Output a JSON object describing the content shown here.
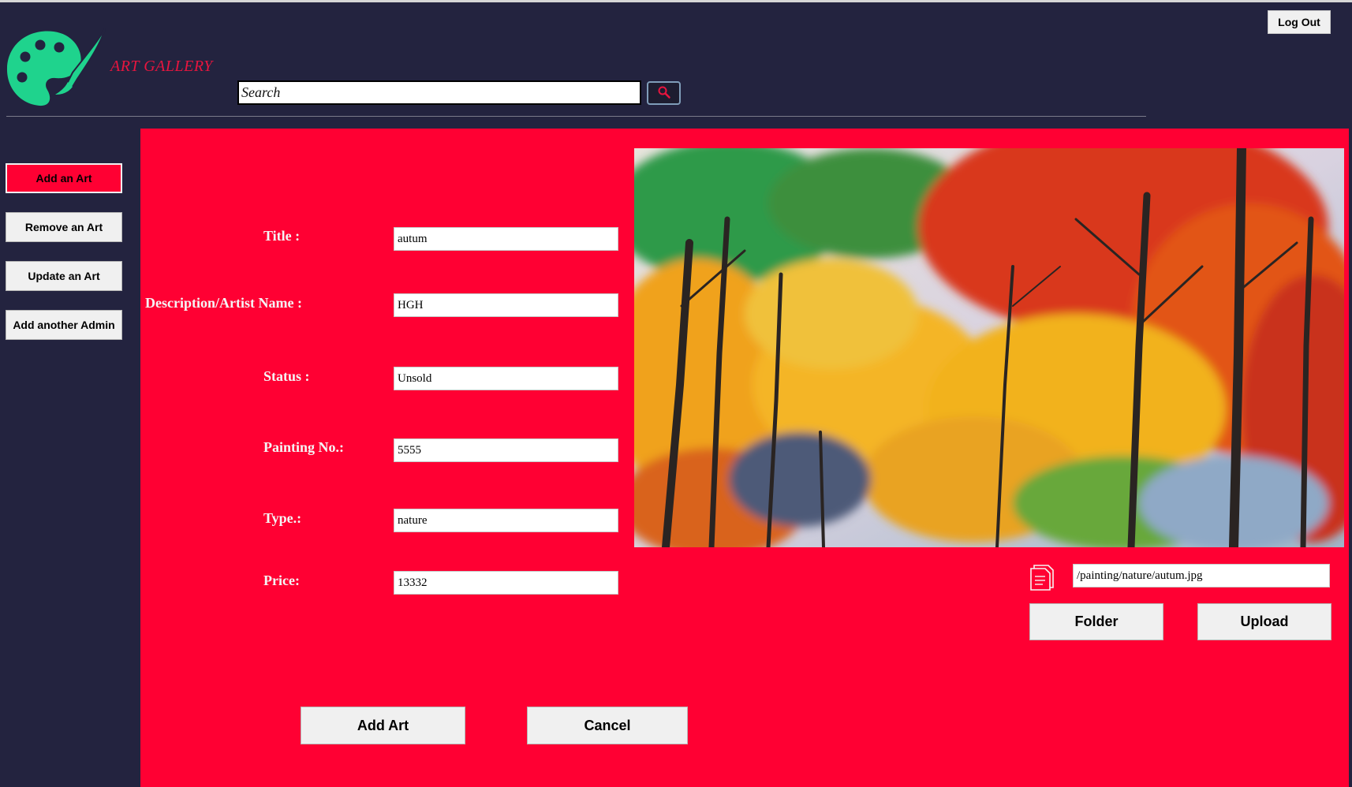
{
  "header": {
    "app_title": "ART GALLERY",
    "logout_label": "Log Out",
    "search": {
      "placeholder": "Search",
      "value": ""
    }
  },
  "sidebar": {
    "items": [
      {
        "label": "Add an Art",
        "active": true
      },
      {
        "label": "Remove an Art",
        "active": false
      },
      {
        "label": "Update an Art",
        "active": false
      },
      {
        "label": "Add another Admin",
        "active": false
      }
    ]
  },
  "form": {
    "title": {
      "label": "Title :",
      "value": "autum"
    },
    "description": {
      "label": "Description/Artist Name :",
      "value": "HGH"
    },
    "status": {
      "label": "Status :",
      "value": "Unsold"
    },
    "painting_no": {
      "label": "Painting No.:",
      "value": "5555"
    },
    "type": {
      "label": "Type.:",
      "value": "nature"
    },
    "price": {
      "label": "Price:",
      "value": "13332"
    }
  },
  "image_panel": {
    "file_path": "/painting/nature/autum.jpg",
    "folder_label": "Folder",
    "upload_label": "Upload"
  },
  "actions": {
    "add_label": "Add Art",
    "cancel_label": "Cancel"
  },
  "colors": {
    "background": "#23233f",
    "panel": "#ff0033",
    "logo": "#1fd38d",
    "accent_text": "#e8153f"
  },
  "icons": {
    "logo": "palette-brush-icon",
    "search": "search-icon",
    "file": "file-icon"
  }
}
